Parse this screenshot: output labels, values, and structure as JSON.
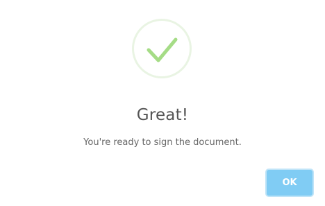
{
  "dialog": {
    "icon": "success-checkmark-icon",
    "title": "Great!",
    "message": "You're ready to sign the document.",
    "ok_label": "OK"
  },
  "colors": {
    "check": "#a5dc86",
    "circle_border": "#e9f4e3",
    "button": "#80ccf4"
  }
}
